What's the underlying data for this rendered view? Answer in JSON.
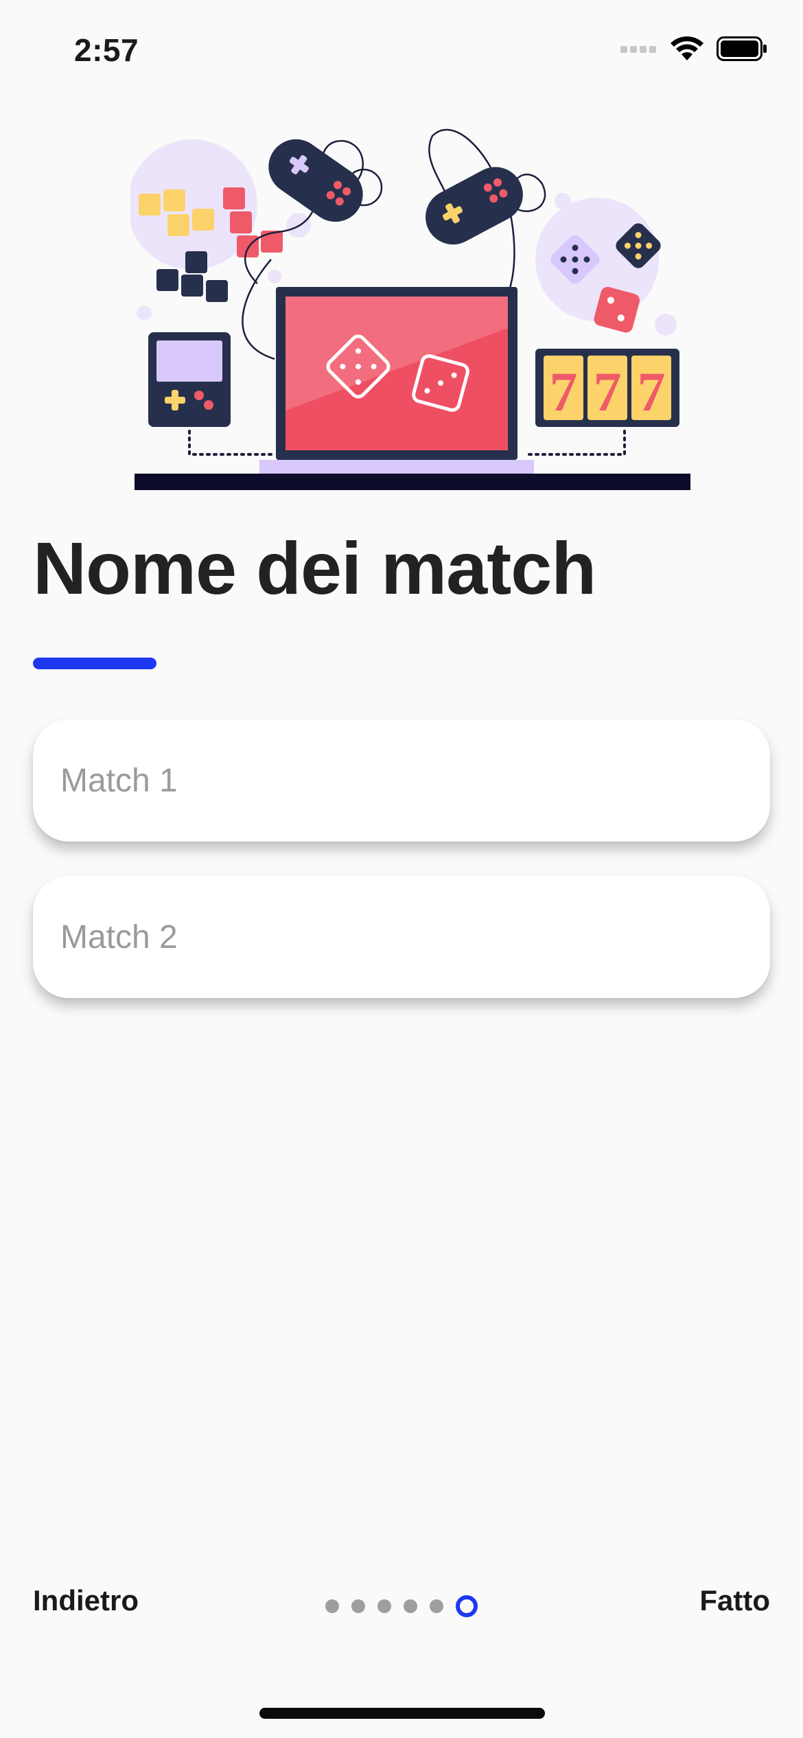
{
  "status_bar": {
    "time": "2:57"
  },
  "title": "Nome dei match",
  "fields": [
    {
      "placeholder": "Match 1",
      "value": ""
    },
    {
      "placeholder": "Match 2",
      "value": ""
    }
  ],
  "footer": {
    "back_label": "Indietro",
    "done_label": "Fatto",
    "pages_total": 6,
    "current_page": 6
  },
  "colors": {
    "accent": "#1e37f0",
    "background": "#fafafa"
  }
}
